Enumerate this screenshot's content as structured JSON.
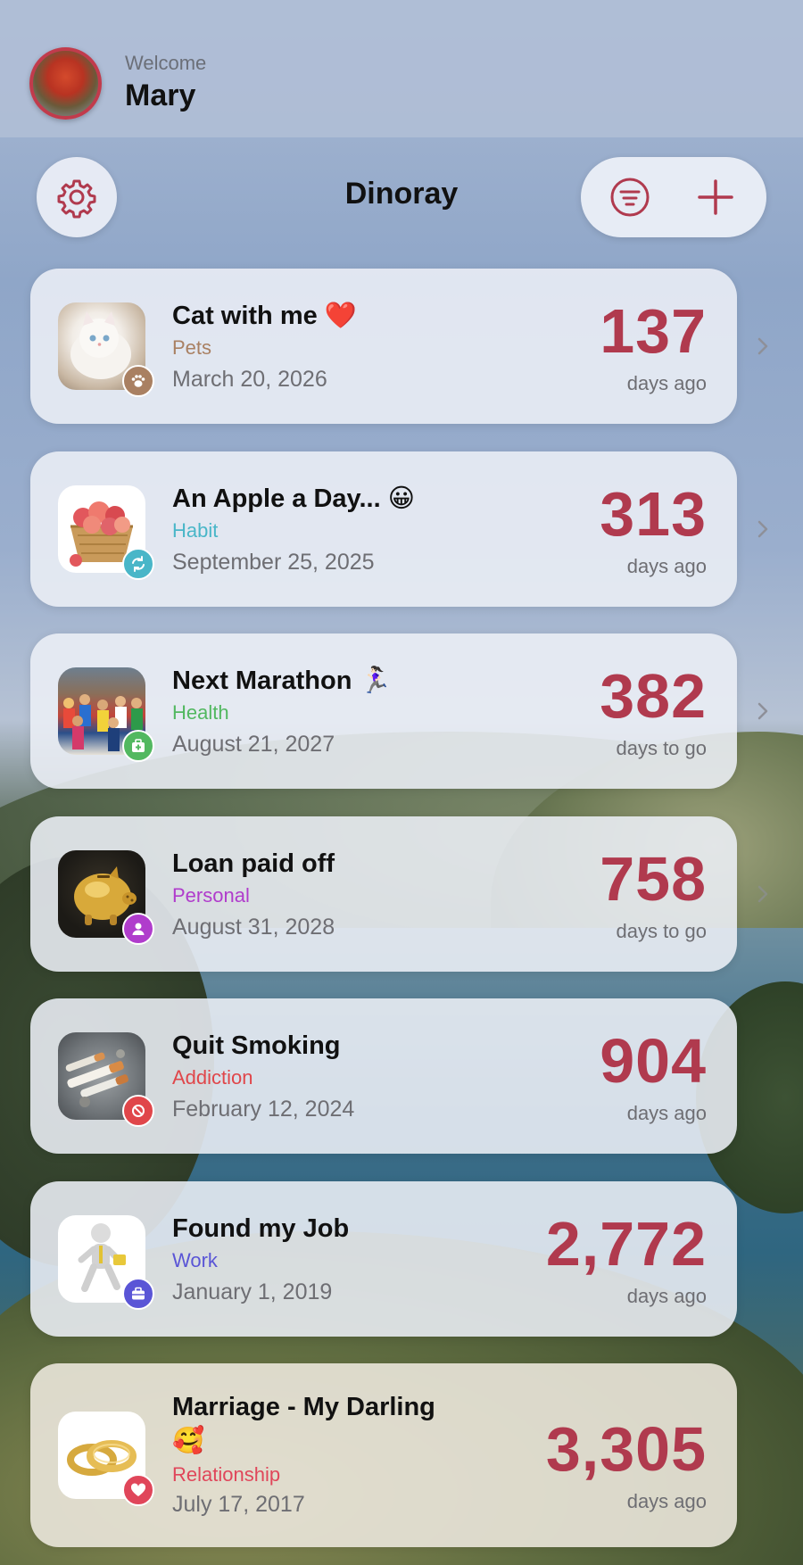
{
  "header": {
    "welcome": "Welcome",
    "username": "Mary"
  },
  "toolbar": {
    "title": "Dinoray",
    "settings_icon": "gear-icon",
    "filter_icon": "filter-icon",
    "add_icon": "plus-icon"
  },
  "colors": {
    "accent": "#b03a4e",
    "card_bg": "#eceff6"
  },
  "events": [
    {
      "title": "Cat with me ❤️",
      "category": "Pets",
      "category_color": "#a98062",
      "date": "March 20, 2026",
      "count": "137",
      "unit": "days ago",
      "badge_icon": "paw-icon",
      "badge_color": "#a98062",
      "thumb": "cat"
    },
    {
      "title": "An Apple a Day... 😀",
      "category": "Habit",
      "category_color": "#49b6c8",
      "date": "September 25, 2025",
      "count": "313",
      "unit": "days ago",
      "badge_icon": "repeat-icon",
      "badge_color": "#49b6c8",
      "thumb": "apples"
    },
    {
      "title": "Next Marathon 🏃🏻‍♀️",
      "category": "Health",
      "category_color": "#52b860",
      "date": "August 21, 2027",
      "count": "382",
      "unit": "days to go",
      "badge_icon": "medkit-icon",
      "badge_color": "#52b860",
      "thumb": "marathon"
    },
    {
      "title": "Loan paid off",
      "category": "Personal",
      "category_color": "#b03ccc",
      "date": "August 31, 2028",
      "count": "758",
      "unit": "days to go",
      "badge_icon": "person-icon",
      "badge_color": "#b03ccc",
      "thumb": "piggy"
    },
    {
      "title": "Quit Smoking",
      "category": "Addiction",
      "category_color": "#e0464a",
      "date": "February 12, 2024",
      "count": "904",
      "unit": "days ago",
      "badge_icon": "prohibited-icon",
      "badge_color": "#e0464a",
      "thumb": "cigarettes"
    },
    {
      "title": "Found my Job",
      "category": "Work",
      "category_color": "#5a55d6",
      "date": "January 1, 2019",
      "count": "2,772",
      "unit": "days ago",
      "badge_icon": "briefcase-icon",
      "badge_color": "#5a55d6",
      "thumb": "job"
    },
    {
      "title": "Marriage - My Darling 🥰",
      "category": "Relationship",
      "category_color": "#e0465a",
      "date": "July 17, 2017",
      "count": "3,305",
      "unit": "days ago",
      "badge_icon": "heart-icon",
      "badge_color": "#e0465a",
      "thumb": "rings"
    }
  ]
}
